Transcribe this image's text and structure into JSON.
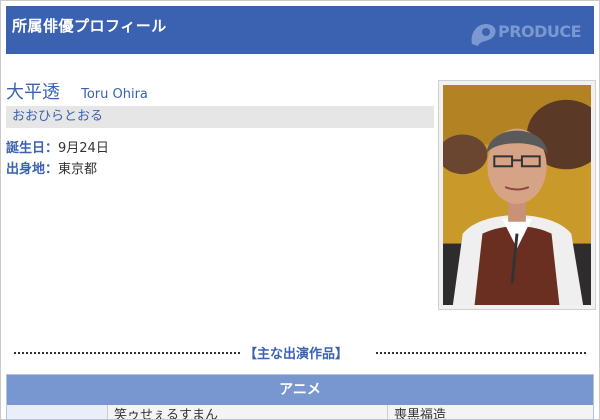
{
  "header": {
    "title": "所属俳優プロフィール",
    "logo_text": "PRODUCE",
    "logo_sub": "",
    "color": "#3a62b0"
  },
  "profile": {
    "name_jp": "大平透",
    "name_en": "Toru Ohira",
    "kana": "おおひらとおる",
    "birthday_label": "誕生日：",
    "birthday_value": "9月24日",
    "birthplace_label": "出身地：",
    "birthplace_value": "東京都"
  },
  "section": {
    "title": "【主な出演作品】"
  },
  "works": {
    "category": "アニメ",
    "rows": [
      {
        "col1": "",
        "col2": "笑ゥせぇるすまん",
        "col3": "喪黒福造"
      }
    ]
  },
  "colors": {
    "accent": "#3a62b0",
    "table_header": "#7896d0",
    "kana_bar": "#e6e6e6"
  }
}
